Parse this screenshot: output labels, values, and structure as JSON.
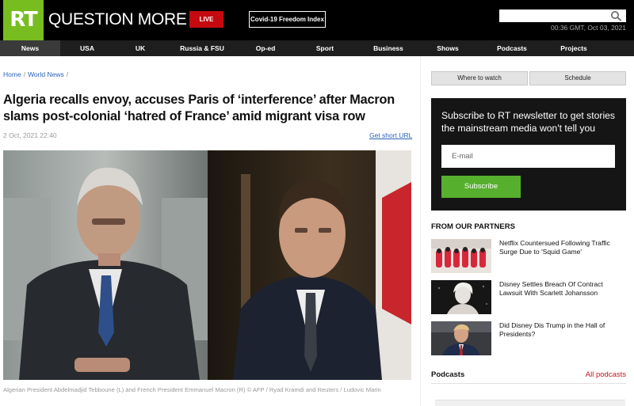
{
  "header": {
    "logo": "RT",
    "tagline": "QUESTION MORE",
    "live_label": "LIVE",
    "covid_label": "Covid-19 Freedom Index",
    "search_placeholder": "",
    "datetime": "00:36 GMT, Oct 03, 2021"
  },
  "nav": {
    "items": [
      {
        "label": "News",
        "active": true
      },
      {
        "label": "USA"
      },
      {
        "label": "UK"
      },
      {
        "label": "Russia & FSU"
      },
      {
        "label": "Op-ed"
      },
      {
        "label": "Sport"
      },
      {
        "label": "Business"
      },
      {
        "label": "Shows"
      },
      {
        "label": "Podcasts"
      },
      {
        "label": "Projects"
      }
    ]
  },
  "article": {
    "breadcrumb": [
      "Home",
      "World News"
    ],
    "headline": "Algeria recalls envoy, accuses Paris of ‘interference’ after Macron slams post-colonial ‘hatred of France’ amid migrant visa row",
    "date": "2 Oct, 2021 22:40",
    "short_url_label": "Get short URL",
    "caption": "Algerian President Abdelmadjid Tebboune (L) and French President Emmanuel Macron (R) © AFP / Ryad Kramdi and Reuters / Ludovic Marin"
  },
  "sidebar": {
    "where_to_watch": "Where to watch",
    "schedule": "Schedule",
    "newsletter": {
      "text": "Subscribe to RT newsletter to get stories the mainstream media won't tell you",
      "email_placeholder": "E-mail",
      "submit_label": "Subscribe"
    },
    "partners_title": "FROM OUR PARTNERS",
    "partners": [
      {
        "title": "Netflix Countersued Following Traffic Surge Due to 'Squid Game'"
      },
      {
        "title": "Disney Settles Breach Of Contract Lawsuit With Scarlett Johansson"
      },
      {
        "title": "Did Disney Dis Trump in the Hall of Presidents?"
      }
    ],
    "podcasts_title": "Podcasts",
    "all_podcasts_label": "All podcasts"
  },
  "colors": {
    "brand_green": "#77bd1f",
    "live_red": "#c40a10",
    "link_blue": "#2a63b8",
    "subscribe_green": "#56b02e",
    "podcasts_red": "#c4161c"
  }
}
